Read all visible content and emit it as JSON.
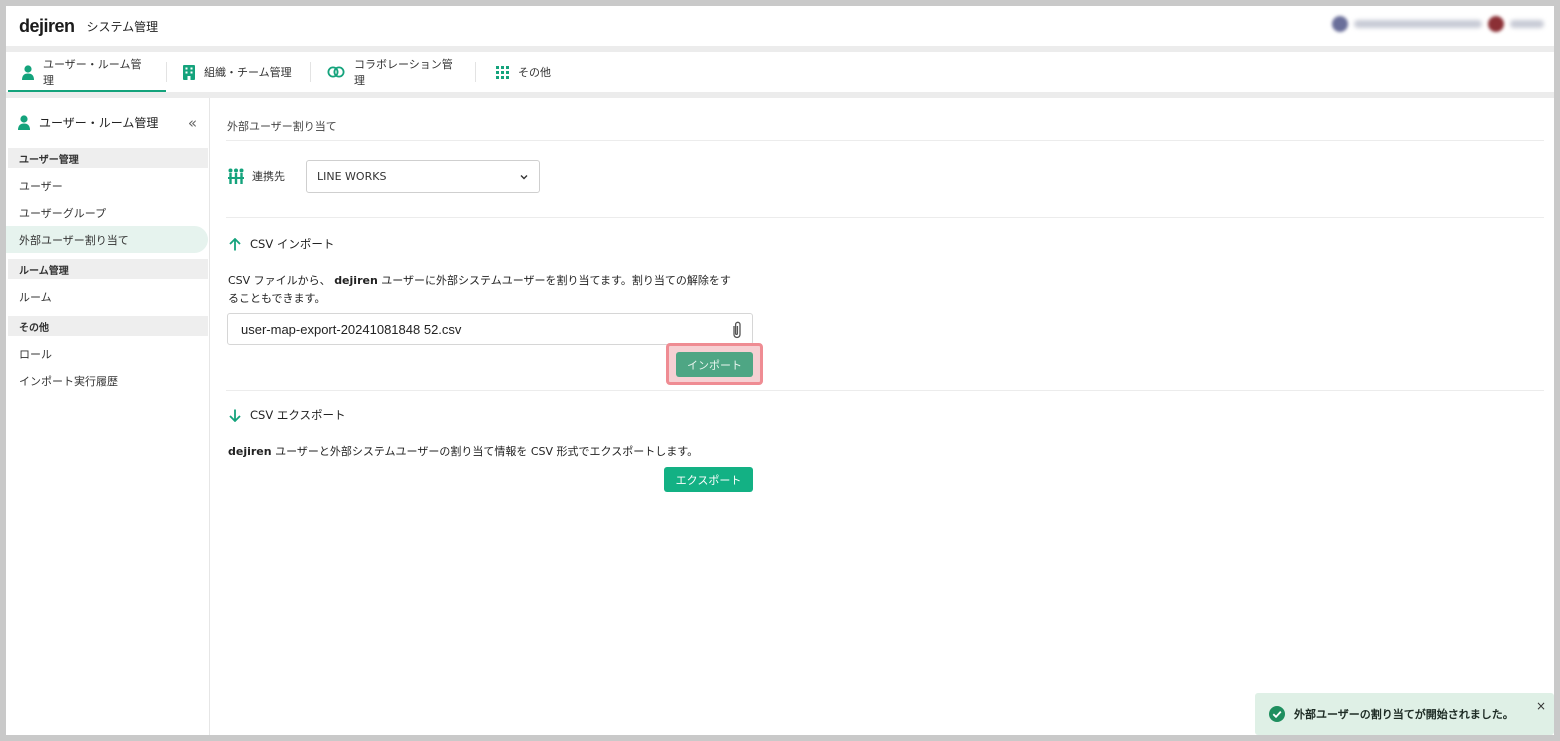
{
  "header": {
    "logo": "dejiren",
    "app_title": "システム管理"
  },
  "tabs": [
    {
      "label": "ユーザー・ルーム管理",
      "icon": "user-icon",
      "active": true
    },
    {
      "label": "組織・チーム管理",
      "icon": "building-icon"
    },
    {
      "label": "コラボレーション管理",
      "icon": "link-icon"
    },
    {
      "label": "その他",
      "icon": "grid-icon"
    }
  ],
  "sidebar": {
    "title": "ユーザー・ルーム管理",
    "sections": [
      {
        "header": "ユーザー管理",
        "items": [
          "ユーザー",
          "ユーザーグループ",
          "外部ユーザー割り当て"
        ]
      },
      {
        "header": "ルーム管理",
        "items": [
          "ルーム"
        ]
      },
      {
        "header": "その他",
        "items": [
          "ロール",
          "インポート実行履歴"
        ]
      }
    ],
    "active_item": "外部ユーザー割り当て"
  },
  "main": {
    "breadcrumb": "外部ユーザー割り当て",
    "connection_label": "連携先",
    "connection_value": "LINE WORKS",
    "import": {
      "title": "CSV インポート",
      "desc_line1_a": "CSV ファイルから、",
      "desc_line1_b": "dejiren",
      "desc_line1_c": "ユーザーに外部システムユーザーを割り当てます。割り当ての解除をす",
      "desc_line2": "ることもできます。",
      "file_name": "user-map-export-20241081848 52.csv",
      "button": "インポート"
    },
    "export": {
      "title": "CSV エクスポート",
      "desc_a": "dejiren",
      "desc_b": "ユーザーと外部システムユーザーの割り当て情報を",
      "desc_c": "CSV",
      "desc_d": "形式でエクスポートします。",
      "button": "エクスポート"
    }
  },
  "toast": {
    "message": "外部ユーザーの割り当てが開始されました。",
    "close": "×"
  },
  "colors": {
    "accent": "#14a37c",
    "highlight": "#ef8c93",
    "toast_bg": "#dff0e6"
  }
}
